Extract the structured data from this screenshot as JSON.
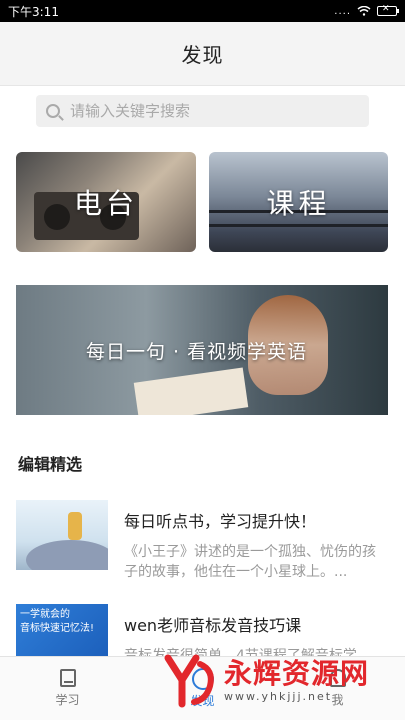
{
  "status_bar": {
    "time": "下午3:11",
    "signal": "....",
    "wifi_icon": "wifi-icon",
    "battery_icon": "battery-icon"
  },
  "header": {
    "title": "发现"
  },
  "search": {
    "placeholder": "请输入关键字搜索"
  },
  "cards": [
    {
      "label": "电台"
    },
    {
      "label": "课程"
    }
  ],
  "banner": {
    "label": "每日一句 · 看视频学英语"
  },
  "section": {
    "title": "编辑精选"
  },
  "articles": [
    {
      "title": "每日听点书，学习提升快！",
      "desc": "《小王子》讲述的是一个孤独、忧伤的孩子的故事，他住在一个小星球上。..."
    },
    {
      "title": "wen老师音标发音技巧课",
      "desc": "音标发音很简单，4节课程了解音标学",
      "thumb_line1": "一学就会的",
      "thumb_line2": "音标快速记忆法!"
    }
  ],
  "bottom_nav": [
    {
      "label": "学习",
      "icon": "book-icon"
    },
    {
      "label": "发现",
      "icon": "discover-icon"
    },
    {
      "label": "我",
      "icon": "me-icon"
    }
  ],
  "watermark": {
    "name": "永辉资源网",
    "url": "www.yhkjjj.net"
  },
  "colors": {
    "accent": "#2d7bd8",
    "watermark_red": "#e2272c"
  }
}
